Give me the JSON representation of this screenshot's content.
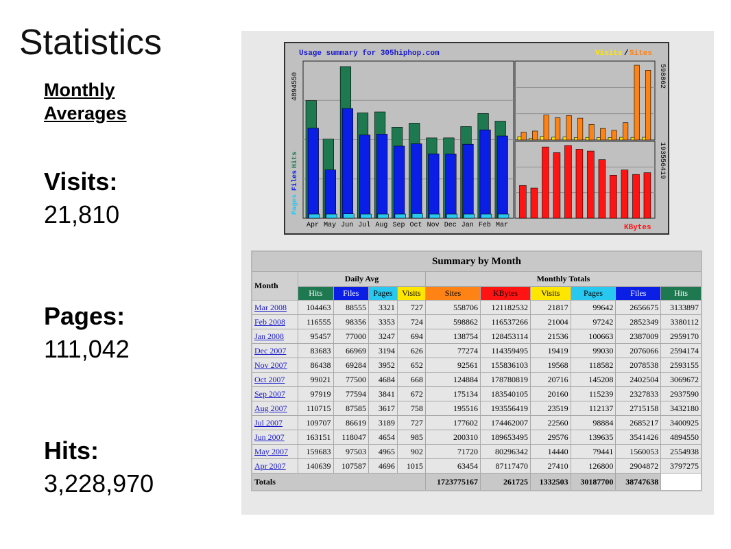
{
  "slide": {
    "title": "Statistics",
    "avg_heading": "Monthly Averages",
    "stats": [
      {
        "label": "Visits:",
        "value": "21,810"
      },
      {
        "label": "Pages:",
        "value": "111,042"
      },
      {
        "label": "Hits:",
        "value": "3,228,970"
      }
    ]
  },
  "graph": {
    "title": "Usage summary for 305hiphop.com",
    "legend_visits": "Visits",
    "legend_sep": "/",
    "legend_sites": "Sites",
    "axis_left_max": "4894550",
    "axis_left_label_pages": "Pages",
    "axis_left_label_files": "Files",
    "axis_left_label_hits": "Hits",
    "axis_right_top": "598862",
    "axis_right_bottom": "193556419",
    "kbytes_label": "KBytes",
    "months": [
      "Apr",
      "May",
      "Jun",
      "Jul",
      "Aug",
      "Sep",
      "Oct",
      "Nov",
      "Dec",
      "Jan",
      "Feb",
      "Mar"
    ],
    "colors": {
      "hits": "#1e7850",
      "files": "#0a1ee6",
      "pages": "#28c8f0",
      "visits": "#ff9b14",
      "sites": "#ff8214",
      "kbytes": "#ff1414",
      "bg": "#c0c0c0"
    }
  },
  "chart_data": {
    "type": "bar",
    "categories": [
      "Apr",
      "May",
      "Jun",
      "Jul",
      "Aug",
      "Sep",
      "Oct",
      "Nov",
      "Dec",
      "Jan",
      "Feb",
      "Mar"
    ],
    "series": [
      {
        "name": "Hits",
        "values": [
          3797275,
          2554938,
          4894550,
          3400925,
          3432180,
          2937590,
          3069672,
          2593155,
          2594174,
          2959170,
          3380112,
          3133897
        ]
      },
      {
        "name": "Files",
        "values": [
          2904872,
          1560053,
          3541426,
          2685217,
          2715158,
          2327833,
          2402504,
          2078538,
          2076066,
          2387009,
          2852349,
          2656675
        ]
      },
      {
        "name": "Pages",
        "values": [
          126800,
          79441,
          139635,
          98884,
          112137,
          115239,
          145208,
          118582,
          99030,
          100663,
          97242,
          99642
        ]
      },
      {
        "name": "Visits",
        "values": [
          27410,
          14440,
          29576,
          22560,
          23519,
          20160,
          20716,
          19568,
          19419,
          21536,
          21004,
          21817
        ]
      },
      {
        "name": "Sites",
        "values": [
          63454,
          71720,
          200310,
          177602,
          195516,
          175134,
          124884,
          92561,
          77274,
          138754,
          598862,
          558706
        ]
      },
      {
        "name": "KBytes",
        "values": [
          87117470,
          80296342,
          189653495,
          174462007,
          193556419,
          183540105,
          178780819,
          155836103,
          114359495,
          128453114,
          116537266,
          121182532
        ]
      }
    ]
  },
  "table": {
    "caption": "Summary by Month",
    "month_header": "Month",
    "daily_avg_header": "Daily Avg",
    "monthly_totals_header": "Monthly Totals",
    "daily_cols": [
      {
        "label": "Hits",
        "color": "#1e7850",
        "text": "#ffffff"
      },
      {
        "label": "Files",
        "color": "#0a1ee6",
        "text": "#ffffff"
      },
      {
        "label": "Pages",
        "color": "#28c8f0",
        "text": "#000000"
      },
      {
        "label": "Visits",
        "color": "#ffe600",
        "text": "#000000"
      }
    ],
    "total_cols": [
      {
        "label": "Sites",
        "color": "#ff8214",
        "text": "#000000"
      },
      {
        "label": "KBytes",
        "color": "#ff1414",
        "text": "#000000"
      },
      {
        "label": "Visits",
        "color": "#ffe600",
        "text": "#000000"
      },
      {
        "label": "Pages",
        "color": "#28c8f0",
        "text": "#000000"
      },
      {
        "label": "Files",
        "color": "#0a1ee6",
        "text": "#ffffff"
      },
      {
        "label": "Hits",
        "color": "#1e7850",
        "text": "#ffffff"
      }
    ],
    "rows": [
      {
        "month": "Mar 2008",
        "vals": [
          "104463",
          "88555",
          "3321",
          "727",
          "558706",
          "121182532",
          "21817",
          "99642",
          "2656675",
          "3133897"
        ]
      },
      {
        "month": "Feb 2008",
        "vals": [
          "116555",
          "98356",
          "3353",
          "724",
          "598862",
          "116537266",
          "21004",
          "97242",
          "2852349",
          "3380112"
        ]
      },
      {
        "month": "Jan 2008",
        "vals": [
          "95457",
          "77000",
          "3247",
          "694",
          "138754",
          "128453114",
          "21536",
          "100663",
          "2387009",
          "2959170"
        ]
      },
      {
        "month": "Dec 2007",
        "vals": [
          "83683",
          "66969",
          "3194",
          "626",
          "77274",
          "114359495",
          "19419",
          "99030",
          "2076066",
          "2594174"
        ]
      },
      {
        "month": "Nov 2007",
        "vals": [
          "86438",
          "69284",
          "3952",
          "652",
          "92561",
          "155836103",
          "19568",
          "118582",
          "2078538",
          "2593155"
        ]
      },
      {
        "month": "Oct 2007",
        "vals": [
          "99021",
          "77500",
          "4684",
          "668",
          "124884",
          "178780819",
          "20716",
          "145208",
          "2402504",
          "3069672"
        ]
      },
      {
        "month": "Sep 2007",
        "vals": [
          "97919",
          "77594",
          "3841",
          "672",
          "175134",
          "183540105",
          "20160",
          "115239",
          "2327833",
          "2937590"
        ]
      },
      {
        "month": "Aug 2007",
        "vals": [
          "110715",
          "87585",
          "3617",
          "758",
          "195516",
          "193556419",
          "23519",
          "112137",
          "2715158",
          "3432180"
        ]
      },
      {
        "month": "Jul 2007",
        "vals": [
          "109707",
          "86619",
          "3189",
          "727",
          "177602",
          "174462007",
          "22560",
          "98884",
          "2685217",
          "3400925"
        ]
      },
      {
        "month": "Jun 2007",
        "vals": [
          "163151",
          "118047",
          "4654",
          "985",
          "200310",
          "189653495",
          "29576",
          "139635",
          "3541426",
          "4894550"
        ]
      },
      {
        "month": "May 2007",
        "vals": [
          "159683",
          "97503",
          "4965",
          "902",
          "71720",
          "80296342",
          "14440",
          "79441",
          "1560053",
          "2554938"
        ]
      },
      {
        "month": "Apr 2007",
        "vals": [
          "140639",
          "107587",
          "4696",
          "1015",
          "63454",
          "87117470",
          "27410",
          "126800",
          "2904872",
          "3797275"
        ]
      }
    ],
    "totals_label": "Totals",
    "totals": [
      "1723775167",
      "261725",
      "1332503",
      "30187700",
      "38747638"
    ]
  }
}
